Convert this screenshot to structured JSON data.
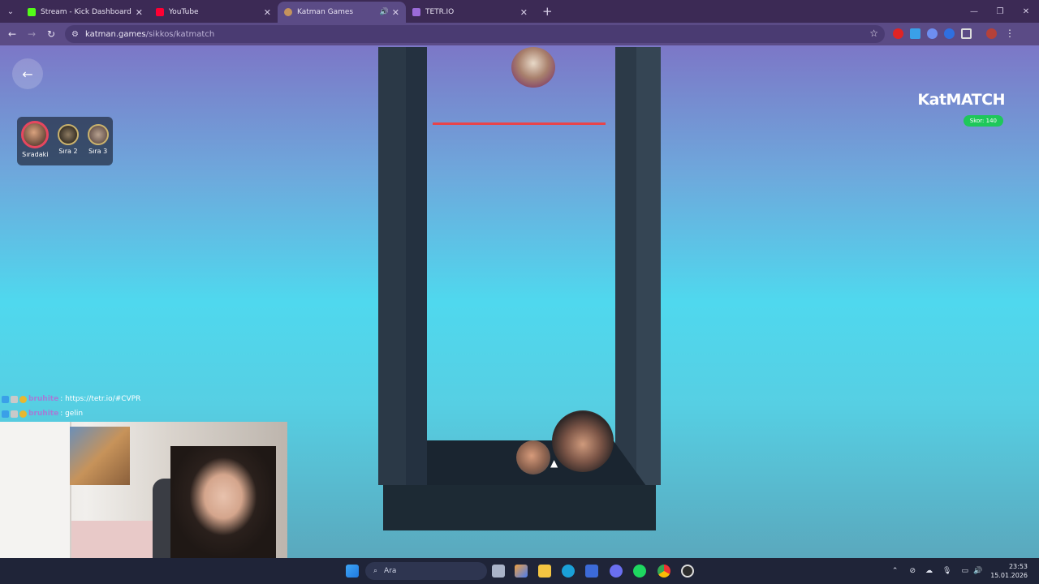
{
  "browser": {
    "tabs": [
      {
        "title": "Stream - Kick Dashboard",
        "favicon": "kick-icon",
        "color": "#53fc18"
      },
      {
        "title": "YouTube",
        "favicon": "youtube-icon",
        "color": "#ff0033"
      },
      {
        "title": "Katman Games",
        "favicon": "katman-icon",
        "color": "#c4935d",
        "active": true
      },
      {
        "title": "TETR.IO",
        "favicon": "tetrio-icon",
        "color": "#9b6bd9"
      }
    ],
    "address": {
      "host": "katman.games",
      "path": "/sikkos/katmatch"
    }
  },
  "game": {
    "back_icon": "←",
    "logo": "KatMATCH",
    "score": "Skor: 140",
    "queue": [
      {
        "label": "Sıradaki"
      },
      {
        "label": "Sıra 2"
      },
      {
        "label": "Sıra 3"
      }
    ]
  },
  "chat": [
    {
      "user": "bruhite",
      "message": " : https://tetr.io/#CVPR"
    },
    {
      "user": "bruhite",
      "message": " : gelin"
    }
  ],
  "taskbar": {
    "search_placeholder": "Ara",
    "time": "23:53",
    "date": "15.01.2026"
  },
  "colors": {
    "accent": "#5b4b86",
    "score_badge": "#1ec85a",
    "danger_line": "#e8444a"
  }
}
